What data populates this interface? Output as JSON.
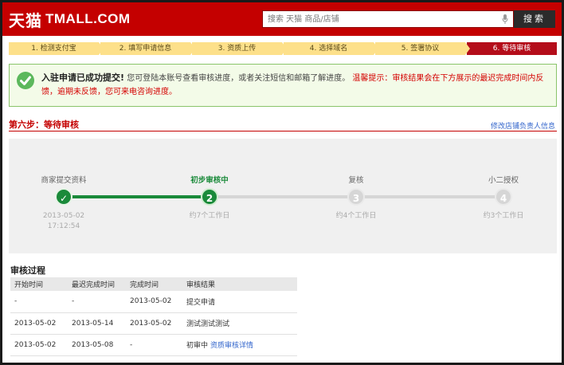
{
  "header": {
    "logo_cn": "天猫",
    "logo_en": "TMALL.COM",
    "search_placeholder": "搜索 天猫 商品/店铺",
    "search_button": "搜索",
    "brand_color": "#c40000"
  },
  "steps": [
    {
      "label": "1. 检测支付宝"
    },
    {
      "label": "2. 填写申请信息"
    },
    {
      "label": "3. 资质上传"
    },
    {
      "label": "4. 选择域名"
    },
    {
      "label": "5. 签署协议"
    },
    {
      "label": "6. 等待审核"
    }
  ],
  "notice": {
    "title": "入驻申请已成功提交!",
    "body": "您可登陆本账号查看审核进度，或者关注短信和邮箱了解进度。",
    "warning": "温馨提示：审核结果会在下方展示的最迟完成时间内反馈，逾期未反馈，您可来电咨询进度。"
  },
  "section": {
    "title": "第六步：等待审核",
    "link": "修改店铺负责人信息"
  },
  "progress": [
    {
      "label": "商家提交资料",
      "node": "✓",
      "sub1": "2013-05-02",
      "sub2": "17:12:54",
      "state": "done"
    },
    {
      "label": "初步审核中",
      "node": "2",
      "sub1": "约7个工作日",
      "sub2": "",
      "state": "active"
    },
    {
      "label": "复核",
      "node": "3",
      "sub1": "约4个工作日",
      "sub2": "",
      "state": "todo"
    },
    {
      "label": "小二授权",
      "node": "4",
      "sub1": "约3个工作日",
      "sub2": "",
      "state": "todo"
    }
  ],
  "history": {
    "title": "审核过程",
    "headers": [
      "开始时间",
      "最迟完成时间",
      "完成时间",
      "审核结果"
    ],
    "rows": [
      [
        "-",
        "-",
        "2013-05-02",
        "提交申请",
        ""
      ],
      [
        "2013-05-02",
        "2013-05-14",
        "2013-05-02",
        "测试测试测试",
        ""
      ],
      [
        "2013-05-02",
        "2013-05-08",
        "-",
        "初审中",
        "资质审核详情"
      ]
    ]
  }
}
